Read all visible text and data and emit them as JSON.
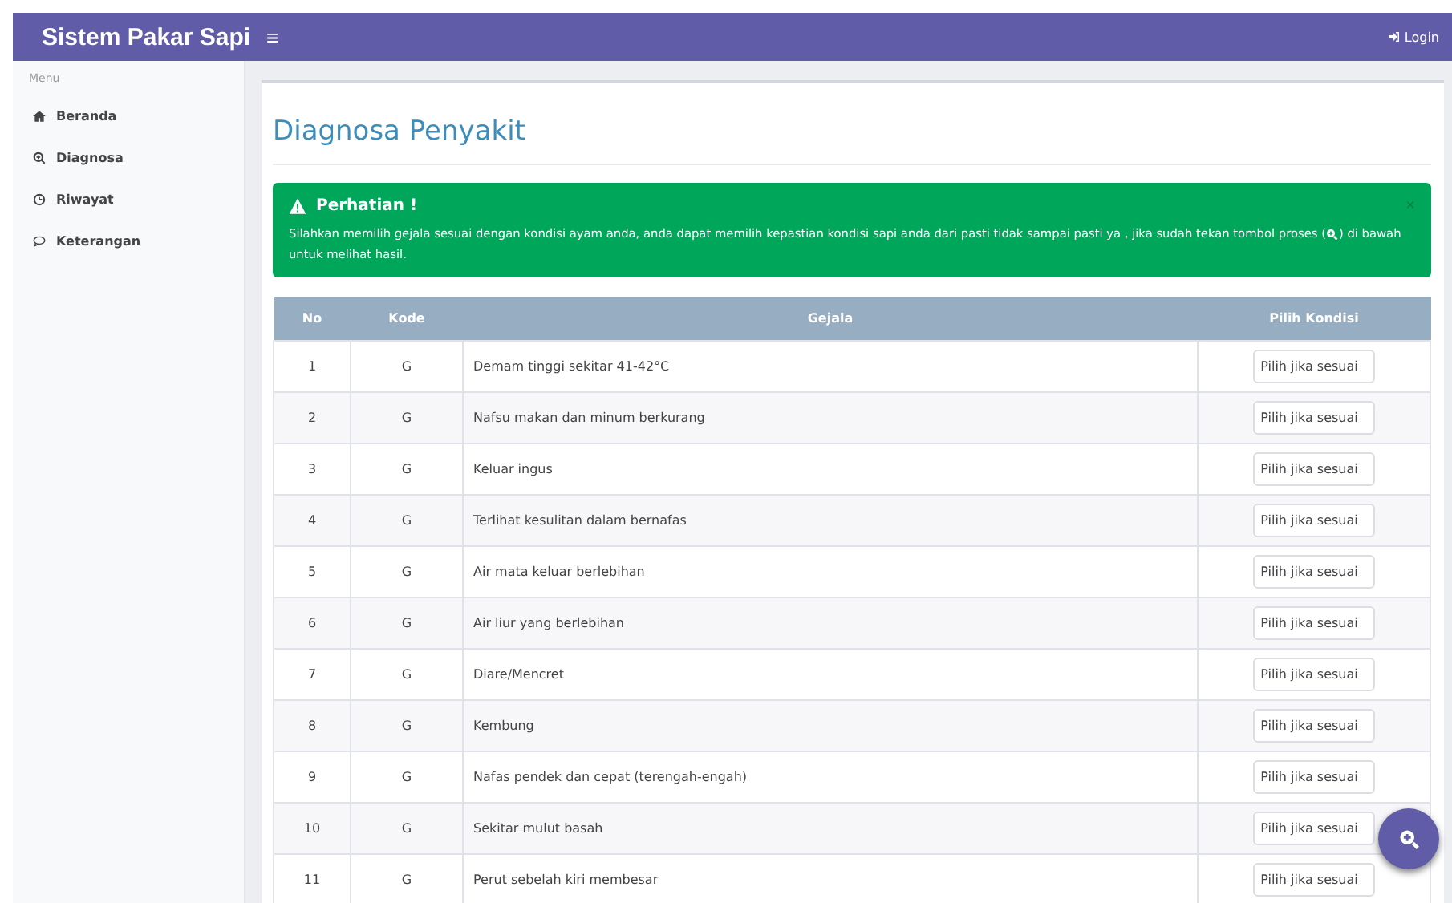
{
  "navbar": {
    "brand": "Sistem Pakar Sapi",
    "menu_toggle": "≡",
    "login": "Login"
  },
  "sidebar": {
    "heading": "Menu",
    "items": [
      {
        "label": "Beranda",
        "kind": "home",
        "selected": false
      },
      {
        "label": "Diagnosa",
        "kind": "search",
        "selected": false
      },
      {
        "label": "Riwayat",
        "kind": "history",
        "selected": false
      },
      {
        "label": "Keterangan",
        "kind": "info",
        "selected": false
      }
    ]
  },
  "page_title": "Diagnosa Penyakit",
  "alert": {
    "title": "Perhatian !",
    "text_before": "Silahkan memilih gejala sesuai dengan kondisi ayam anda, anda dapat memilih kepastian kondisi sapi anda dari pasti tidak sampai pasti ya , jika sudah tekan tombol proses (",
    "text_after": ") di bawah",
    "text_line2": "untuk melihat hasil.",
    "close": "×"
  },
  "table": {
    "columns": [
      "No",
      "Kode",
      "Gejala",
      "Pilih Kondisi"
    ],
    "rows": [
      {
        "no": "1",
        "kode": "G",
        "gejala": "Demam tinggi sekitar 41-42°C",
        "kondisi": "Pilih jika sesuai"
      },
      {
        "no": "2",
        "kode": "G",
        "gejala": "Nafsu makan dan minum berkurang",
        "kondisi": "Pilih jika sesuai"
      },
      {
        "no": "3",
        "kode": "G",
        "gejala": "Keluar ingus",
        "kondisi": "Pilih jika sesuai"
      },
      {
        "no": "4",
        "kode": "G",
        "gejala": "Terlihat kesulitan dalam bernafas",
        "kondisi": "Pilih jika sesuai"
      },
      {
        "no": "5",
        "kode": "G",
        "gejala": "Air mata keluar berlebihan",
        "kondisi": "Pilih jika sesuai"
      },
      {
        "no": "6",
        "kode": "G",
        "gejala": "Air liur yang berlebihan",
        "kondisi": "Pilih jika sesuai"
      },
      {
        "no": "7",
        "kode": "G",
        "gejala": "Diare/Mencret",
        "kondisi": "Pilih jika sesuai"
      },
      {
        "no": "8",
        "kode": "G",
        "gejala": "Kembung",
        "kondisi": "Pilih jika sesuai"
      },
      {
        "no": "9",
        "kode": "G",
        "gejala": "Nafas pendek dan cepat (terengah-engah)",
        "kondisi": "Pilih jika sesuai"
      },
      {
        "no": "10",
        "kode": "G",
        "gejala": "Sekitar mulut basah",
        "kondisi": "Pilih jika sesuai"
      },
      {
        "no": "11",
        "kode": "G",
        "gejala": "Perut sebelah kiri membesar",
        "kondisi": "Pilih jika sesuai"
      }
    ]
  }
}
